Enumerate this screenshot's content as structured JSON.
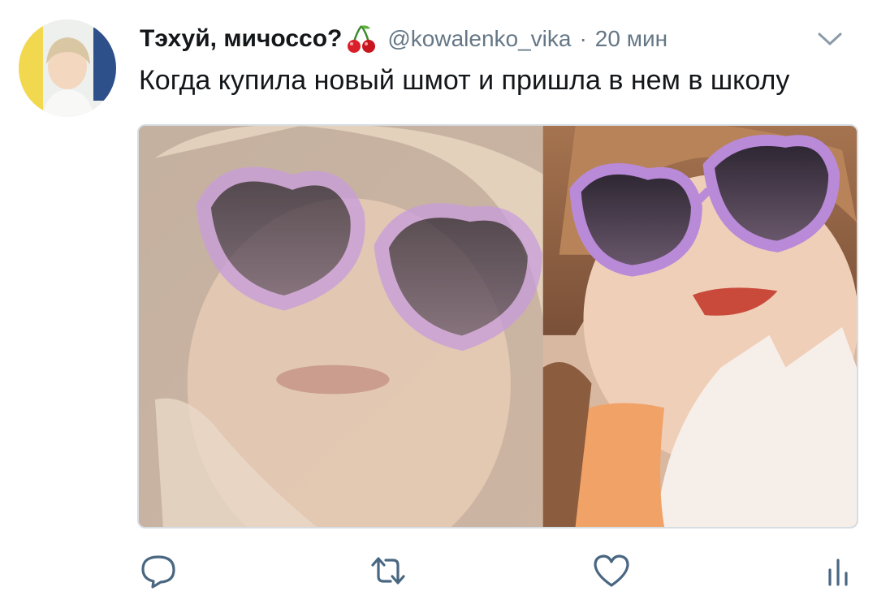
{
  "tweet": {
    "author_name": "Тэхуй, мичоссо?",
    "author_emoji": "cherries-emoji",
    "handle": "@kowalenko_vika",
    "separator": "·",
    "time": "20 мин",
    "text": "Когда купила новый шмот и пришла в нем в школу",
    "media_description_icon": "photo-two-girls-heart-sunglasses"
  },
  "actions": {
    "reply_icon": "reply-icon",
    "retweet_icon": "retweet-icon",
    "like_icon": "heart-icon",
    "stats_icon": "analytics-icon"
  },
  "colors": {
    "text": "#14171a",
    "secondary": "#657786",
    "icon": "#4a6782",
    "border": "#d6dde3"
  }
}
